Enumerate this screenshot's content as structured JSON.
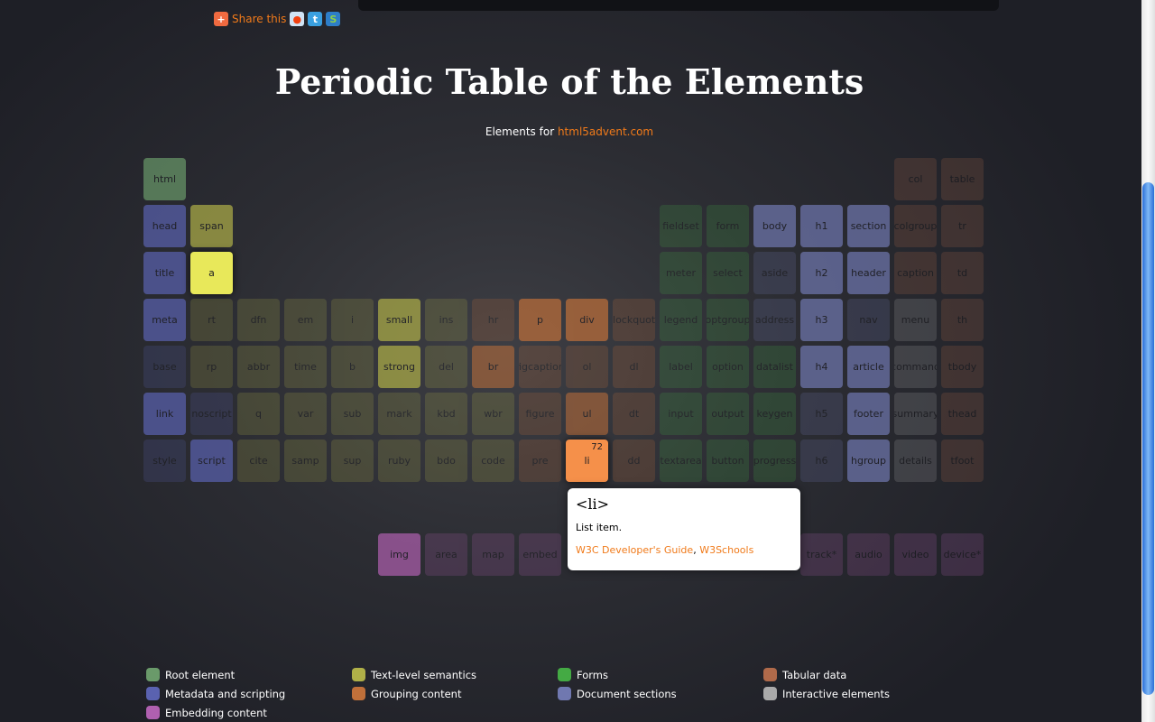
{
  "share": {
    "label": "Share this",
    "icons": [
      "addthis-plus-icon",
      "reddit-icon",
      "twitter-icon",
      "stumbleupon-icon"
    ]
  },
  "title": "Periodic Table of the Elements",
  "subtitle": {
    "text": "Elements for ",
    "link": "html5advent.com"
  },
  "colors": {
    "root": "#6a9a6a",
    "meta": "#5a62b0",
    "text": "#b0b048",
    "forms": "#44aa44",
    "tabular": "#b06a4a",
    "group": "#c0703a",
    "sections": "#7078b0",
    "interactive": "#aaaaaa",
    "embed": "#b060b0",
    "accent": "#f07a1a"
  },
  "rows": [
    [
      [
        0,
        "html",
        "root",
        "on"
      ],
      [
        16,
        "col",
        "tabular",
        "dim"
      ],
      [
        17,
        "table",
        "tabular",
        "dim"
      ]
    ],
    [
      [
        0,
        "head",
        "meta",
        "on"
      ],
      [
        1,
        "span",
        "text",
        "on"
      ],
      [
        11,
        "fieldset",
        "forms",
        "dim"
      ],
      [
        12,
        "form",
        "forms",
        "dim"
      ],
      [
        13,
        "body",
        "sections",
        "on"
      ],
      [
        14,
        "h1",
        "sections",
        "on"
      ],
      [
        15,
        "section",
        "sections",
        "on"
      ],
      [
        16,
        "colgroup",
        "tabular",
        "dim"
      ],
      [
        17,
        "tr",
        "tabular",
        "dim"
      ]
    ],
    [
      [
        0,
        "title",
        "meta",
        "on"
      ],
      [
        1,
        "a",
        "text",
        "hi"
      ],
      [
        11,
        "meter",
        "forms",
        "dim"
      ],
      [
        12,
        "select",
        "forms",
        "dim"
      ],
      [
        13,
        "aside",
        "sections",
        "dim"
      ],
      [
        14,
        "h2",
        "sections",
        "on"
      ],
      [
        15,
        "header",
        "sections",
        "on"
      ],
      [
        16,
        "caption",
        "tabular",
        "dim"
      ],
      [
        17,
        "td",
        "tabular",
        "dim"
      ]
    ],
    [
      [
        0,
        "meta",
        "meta",
        "on"
      ],
      [
        1,
        "rt",
        "text",
        "dim"
      ],
      [
        2,
        "dfn",
        "text",
        "dim"
      ],
      [
        3,
        "em",
        "text",
        "dim"
      ],
      [
        4,
        "i",
        "text",
        "dim"
      ],
      [
        5,
        "small",
        "text",
        "on"
      ],
      [
        6,
        "ins",
        "text",
        "dim"
      ],
      [
        7,
        "hr",
        "group",
        "dim"
      ],
      [
        8,
        "p",
        "group",
        "on"
      ],
      [
        9,
        "div",
        "group",
        "on"
      ],
      [
        10,
        "blockquote",
        "group",
        "dim"
      ],
      [
        11,
        "legend",
        "forms",
        "dim"
      ],
      [
        12,
        "optgroup",
        "forms",
        "dim"
      ],
      [
        13,
        "address",
        "sections",
        "dim"
      ],
      [
        14,
        "h3",
        "sections",
        "on"
      ],
      [
        15,
        "nav",
        "sections",
        "dim"
      ],
      [
        16,
        "menu",
        "interactive",
        "dim"
      ],
      [
        17,
        "th",
        "tabular",
        "dim"
      ]
    ],
    [
      [
        0,
        "base",
        "meta",
        "dim"
      ],
      [
        1,
        "rp",
        "text",
        "dim"
      ],
      [
        2,
        "abbr",
        "text",
        "dim"
      ],
      [
        3,
        "time",
        "text",
        "dim"
      ],
      [
        4,
        "b",
        "text",
        "dim"
      ],
      [
        5,
        "strong",
        "text",
        "on"
      ],
      [
        6,
        "del",
        "text",
        "dim"
      ],
      [
        7,
        "br",
        "group",
        "mid"
      ],
      [
        8,
        "figcaption",
        "group",
        "dim"
      ],
      [
        9,
        "ol",
        "group",
        "dim"
      ],
      [
        10,
        "dl",
        "group",
        "dim"
      ],
      [
        11,
        "label",
        "forms",
        "dim"
      ],
      [
        12,
        "option",
        "forms",
        "dim"
      ],
      [
        13,
        "datalist",
        "forms",
        "dim"
      ],
      [
        14,
        "h4",
        "sections",
        "on"
      ],
      [
        15,
        "article",
        "sections",
        "on"
      ],
      [
        16,
        "command",
        "interactive",
        "dim"
      ],
      [
        17,
        "tbody",
        "tabular",
        "dim"
      ]
    ],
    [
      [
        0,
        "link",
        "meta",
        "on"
      ],
      [
        1,
        "noscript",
        "meta",
        "dim"
      ],
      [
        2,
        "q",
        "text",
        "dim"
      ],
      [
        3,
        "var",
        "text",
        "dim"
      ],
      [
        4,
        "sub",
        "text",
        "dim"
      ],
      [
        5,
        "mark",
        "text",
        "dim"
      ],
      [
        6,
        "kbd",
        "text",
        "dim"
      ],
      [
        7,
        "wbr",
        "text",
        "dim"
      ],
      [
        8,
        "figure",
        "group",
        "dim"
      ],
      [
        9,
        "ul",
        "group",
        "mid"
      ],
      [
        10,
        "dt",
        "group",
        "dim"
      ],
      [
        11,
        "input",
        "forms",
        "dim"
      ],
      [
        12,
        "output",
        "forms",
        "dim"
      ],
      [
        13,
        "keygen",
        "forms",
        "dim"
      ],
      [
        14,
        "h5",
        "sections",
        "dim"
      ],
      [
        15,
        "footer",
        "sections",
        "on"
      ],
      [
        16,
        "summary",
        "interactive",
        "dim"
      ],
      [
        17,
        "thead",
        "tabular",
        "dim"
      ]
    ],
    [
      [
        0,
        "style",
        "meta",
        "dim"
      ],
      [
        1,
        "script",
        "meta",
        "on"
      ],
      [
        2,
        "cite",
        "text",
        "dim"
      ],
      [
        3,
        "samp",
        "text",
        "dim"
      ],
      [
        4,
        "sup",
        "text",
        "dim"
      ],
      [
        5,
        "ruby",
        "text",
        "dim"
      ],
      [
        6,
        "bdo",
        "text",
        "dim"
      ],
      [
        7,
        "code",
        "text",
        "dim"
      ],
      [
        8,
        "pre",
        "group",
        "dim"
      ],
      [
        9,
        "li",
        "group",
        "hi",
        "72"
      ],
      [
        10,
        "dd",
        "group",
        "dim"
      ],
      [
        11,
        "textarea",
        "forms",
        "dim"
      ],
      [
        12,
        "button",
        "forms",
        "dim"
      ],
      [
        13,
        "progress",
        "forms",
        "dim"
      ],
      [
        14,
        "h6",
        "sections",
        "dim"
      ],
      [
        15,
        "hgroup",
        "sections",
        "on"
      ],
      [
        16,
        "details",
        "interactive",
        "dim"
      ],
      [
        17,
        "tfoot",
        "tabular",
        "dim"
      ]
    ],
    [],
    [
      [
        5,
        "img",
        "embed",
        "on"
      ],
      [
        6,
        "area",
        "embed",
        "dim"
      ],
      [
        7,
        "map",
        "embed",
        "dim"
      ],
      [
        8,
        "embed",
        "embed",
        "dim"
      ],
      [
        14,
        "track*",
        "embed",
        "dim"
      ],
      [
        15,
        "audio",
        "embed",
        "dim"
      ],
      [
        16,
        "video",
        "embed",
        "dim"
      ],
      [
        17,
        "device*",
        "embed",
        "dim"
      ]
    ]
  ],
  "tooltip": {
    "title": "<li>",
    "description": "List item.",
    "link1": "W3C Developer's Guide",
    "separator": ", ",
    "link2": "W3Schools"
  },
  "legend": [
    {
      "label": "Root element",
      "cat": "root"
    },
    {
      "label": "Text-level semantics",
      "cat": "text"
    },
    {
      "label": "Forms",
      "cat": "forms"
    },
    {
      "label": "Tabular data",
      "cat": "tabular"
    },
    {
      "label": "Metadata and scripting",
      "cat": "meta"
    },
    {
      "label": "Grouping content",
      "cat": "group"
    },
    {
      "label": "Document sections",
      "cat": "sections"
    },
    {
      "label": "Interactive elements",
      "cat": "interactive"
    },
    {
      "label": "Embedding content",
      "cat": "embed"
    }
  ]
}
